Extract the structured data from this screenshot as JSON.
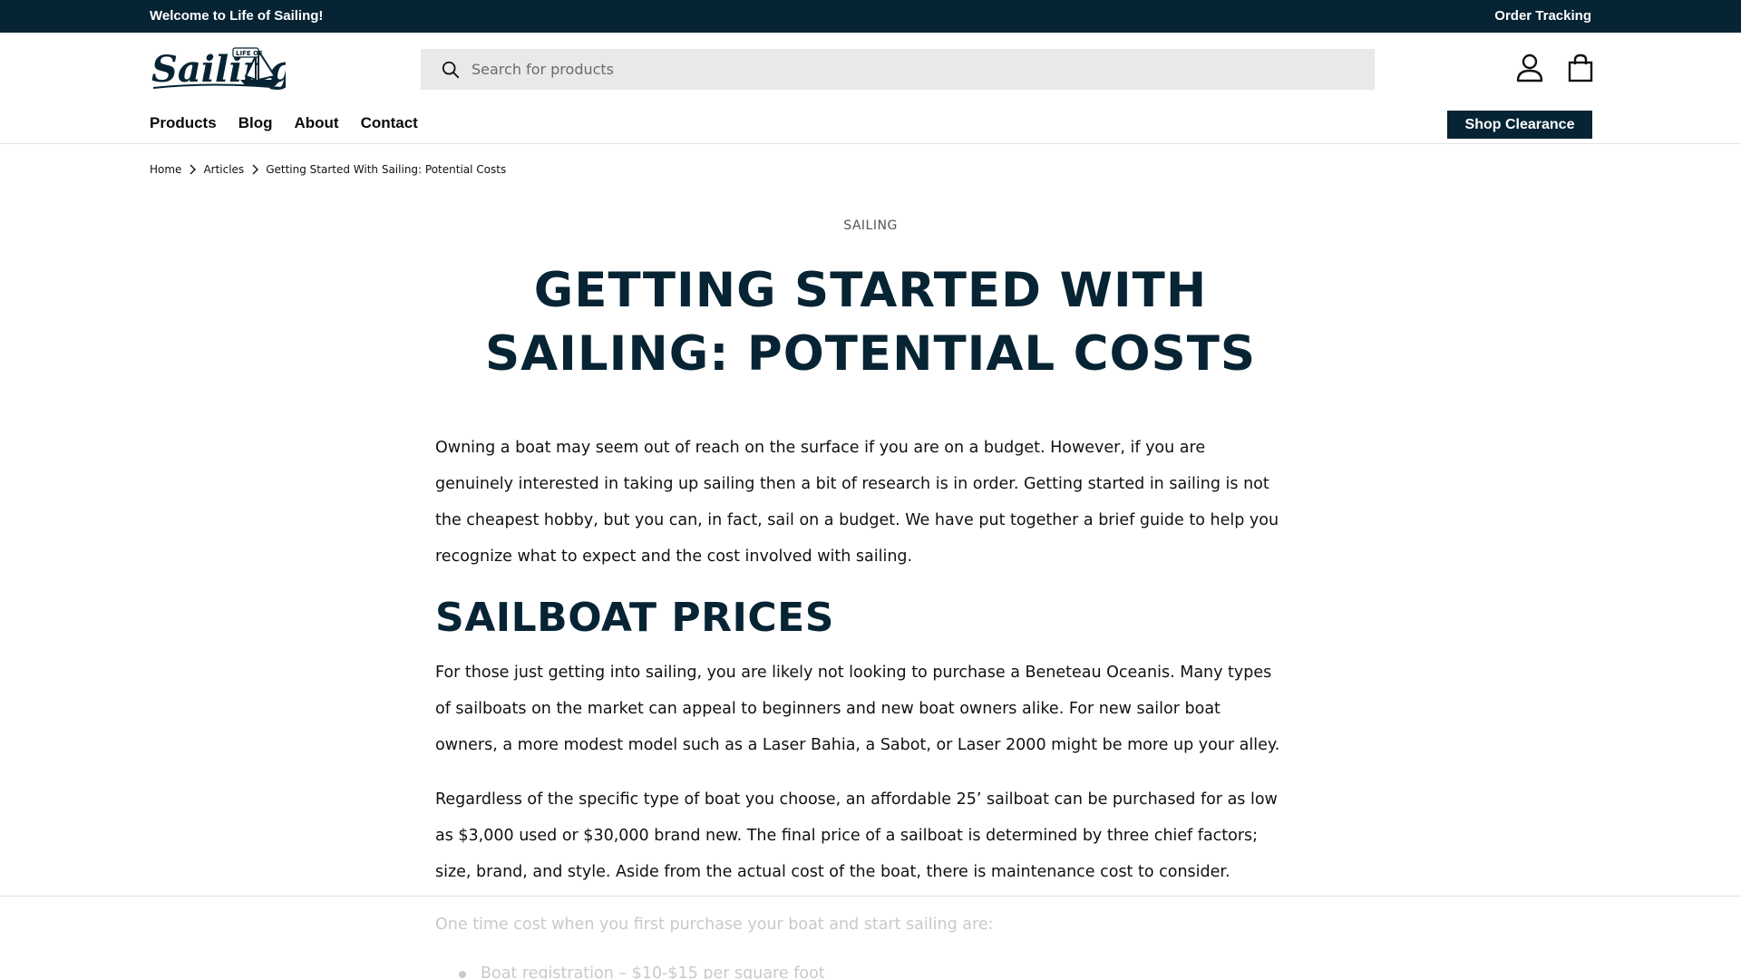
{
  "announcement": {
    "welcome": "Welcome to Life of Sailing!",
    "order_tracking": "Order Tracking"
  },
  "header": {
    "logo_text": "Sailing",
    "logo_badge": "LIFE OF",
    "search_placeholder": "Search for products",
    "icons": [
      "search-icon",
      "account-icon",
      "cart-icon"
    ]
  },
  "nav": {
    "items": [
      "Products",
      "Blog",
      "About",
      "Contact"
    ],
    "clearance_label": "Shop Clearance"
  },
  "breadcrumb": [
    "Home",
    "Articles",
    "Getting Started With Sailing: Potential Costs"
  ],
  "article": {
    "category": "SAILING",
    "title": "GETTING STARTED WITH SAILING: POTENTIAL COSTS",
    "intro": "Owning a boat may seem out of reach on the surface if you are on a budget. However, if you are genuinely interested in taking up sailing then a bit of research is in order. Getting started in sailing is not the cheapest hobby, but you can, in fact, sail on a budget. We have put together a brief guide to help you recognize what to expect and the cost involved with sailing.",
    "section_heading": "SAILBOAT PRICES",
    "para1": "For those just getting into sailing, you are likely not looking to purchase a Beneteau Oceanis. Many types of sailboats on the market can appeal to beginners and new boat owners alike. For new sailor boat owners, a more modest model such as a Laser Bahia, a Sabot, or Laser 2000 might be more up your alley.",
    "para2": "Regardless of the specific type of boat you choose, an affordable 25’ sailboat can be purchased for as low as $3,000 used or $30,000 brand new. The final price of a sailboat is determined by three chief factors; size, brand, and style. Aside from the actual cost of the boat, there is maintenance cost to consider.",
    "faded_line": "One time cost when you first purchase your boat and start sailing are:",
    "faded_list": [
      "Boat registration – $10-$15 per square foot"
    ]
  },
  "colors": {
    "brand_navy": "#072434",
    "search_bg": "#e9e9e9",
    "faded_text": "#c9c9c9"
  }
}
